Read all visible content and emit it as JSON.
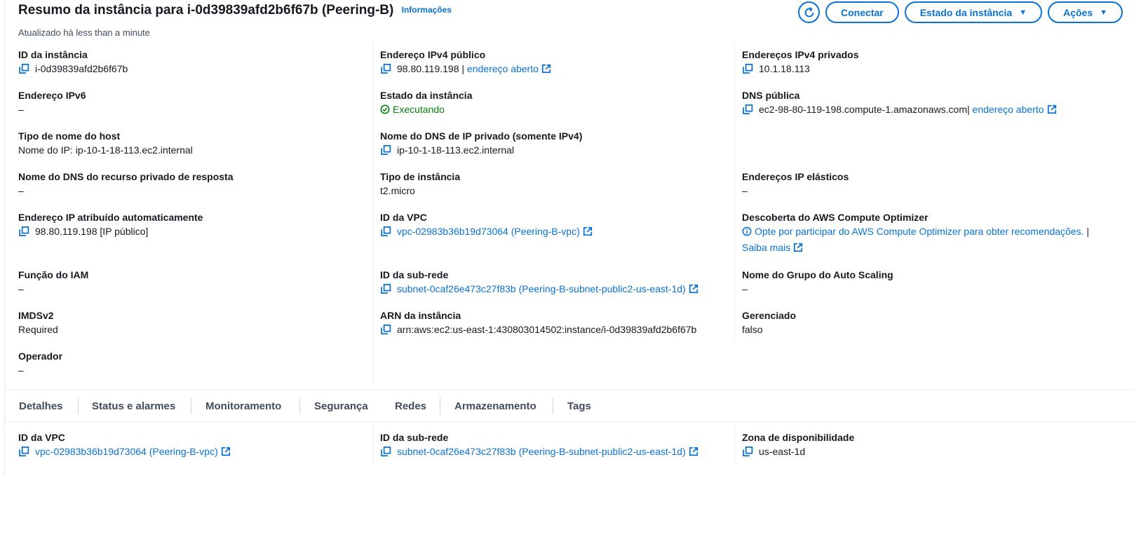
{
  "header": {
    "title": "Resumo da instância para i-0d39839afd2b6f67b (Peering-B)",
    "info_link": "Informações",
    "updated": "Atualizado há less than a minute",
    "buttons": {
      "connect": "Conectar",
      "instance_state": "Estado da instância",
      "actions": "Ações"
    }
  },
  "fields": {
    "instance_id": {
      "label": "ID da instância",
      "value": "i-0d39839afd2b6f67b"
    },
    "public_ipv4": {
      "label": "Endereço IPv4 público",
      "value": "98.80.119.198",
      "separator": "|",
      "link": "endereço aberto"
    },
    "private_ipv4": {
      "label": "Endereços IPv4 privados",
      "value": "10.1.18.113"
    },
    "ipv6": {
      "label": "Endereço IPv6",
      "value": "–"
    },
    "instance_state": {
      "label": "Estado da instância",
      "value": "Executando"
    },
    "public_dns": {
      "label": "DNS pública",
      "value": "ec2-98-80-119-198.compute-1.amazonaws.com",
      "separator": "|",
      "link": "endereço aberto"
    },
    "hostname_type": {
      "label": "Tipo de nome do host",
      "value": "Nome do IP: ip-10-1-18-113.ec2.internal"
    },
    "private_dns": {
      "label": "Nome do DNS de IP privado (somente IPv4)",
      "value": "ip-10-1-18-113.ec2.internal"
    },
    "private_resource_dns": {
      "label": "Nome do DNS do recurso privado de resposta",
      "value": "–"
    },
    "instance_type": {
      "label": "Tipo de instância",
      "value": "t2.micro"
    },
    "elastic_ips": {
      "label": "Endereços IP elásticos",
      "value": "–"
    },
    "auto_ip": {
      "label": "Endereço IP atribuído automaticamente",
      "value": "98.80.119.198 [IP público]"
    },
    "vpc_id": {
      "label": "ID da VPC",
      "value": "vpc-02983b36b19d73064 (Peering-B-vpc)"
    },
    "compute_optimizer": {
      "label": "Descoberta do AWS Compute Optimizer",
      "value": "Opte por participar do AWS Compute Optimizer para obter recomendações.",
      "separator": "|",
      "link": "Saiba mais"
    },
    "iam_role": {
      "label": "Função do IAM",
      "value": "–"
    },
    "subnet_id": {
      "label": "ID da sub-rede",
      "value": "subnet-0caf26e473c27f83b (Peering-B-subnet-public2-us-east-1d)"
    },
    "asg_name": {
      "label": "Nome do Grupo do Auto Scaling",
      "value": "–"
    },
    "imdsv2": {
      "label": "IMDSv2",
      "value": "Required"
    },
    "instance_arn": {
      "label": "ARN da instância",
      "value": "arn:aws:ec2:us-east-1:430803014502:instance/i-0d39839afd2b6f67b"
    },
    "managed": {
      "label": "Gerenciado",
      "value": "falso"
    },
    "operator": {
      "label": "Operador",
      "value": "–"
    }
  },
  "tabs": [
    {
      "label": "Detalhes"
    },
    {
      "label": "Status e alarmes"
    },
    {
      "label": "Monitoramento"
    },
    {
      "label": "Segurança"
    },
    {
      "label": "Redes"
    },
    {
      "label": "Armazenamento"
    },
    {
      "label": "Tags"
    }
  ],
  "active_tab": "Redes",
  "networking": {
    "vpc_id": {
      "label": "ID da VPC",
      "value": "vpc-02983b36b19d73064 (Peering-B-vpc)"
    },
    "subnet_id": {
      "label": "ID da sub-rede",
      "value": "subnet-0caf26e473c27f83b (Peering-B-subnet-public2-us-east-1d)"
    },
    "az": {
      "label": "Zona de disponibilidade",
      "value": "us-east-1d"
    }
  },
  "colors": {
    "link": "#0972d3",
    "success": "#037f0c",
    "text": "#16191f",
    "divider": "#e9ebed"
  },
  "icons": [
    "refresh-icon",
    "caret-down-icon",
    "copy-icon",
    "external-link-icon",
    "status-success-icon",
    "info-icon"
  ]
}
